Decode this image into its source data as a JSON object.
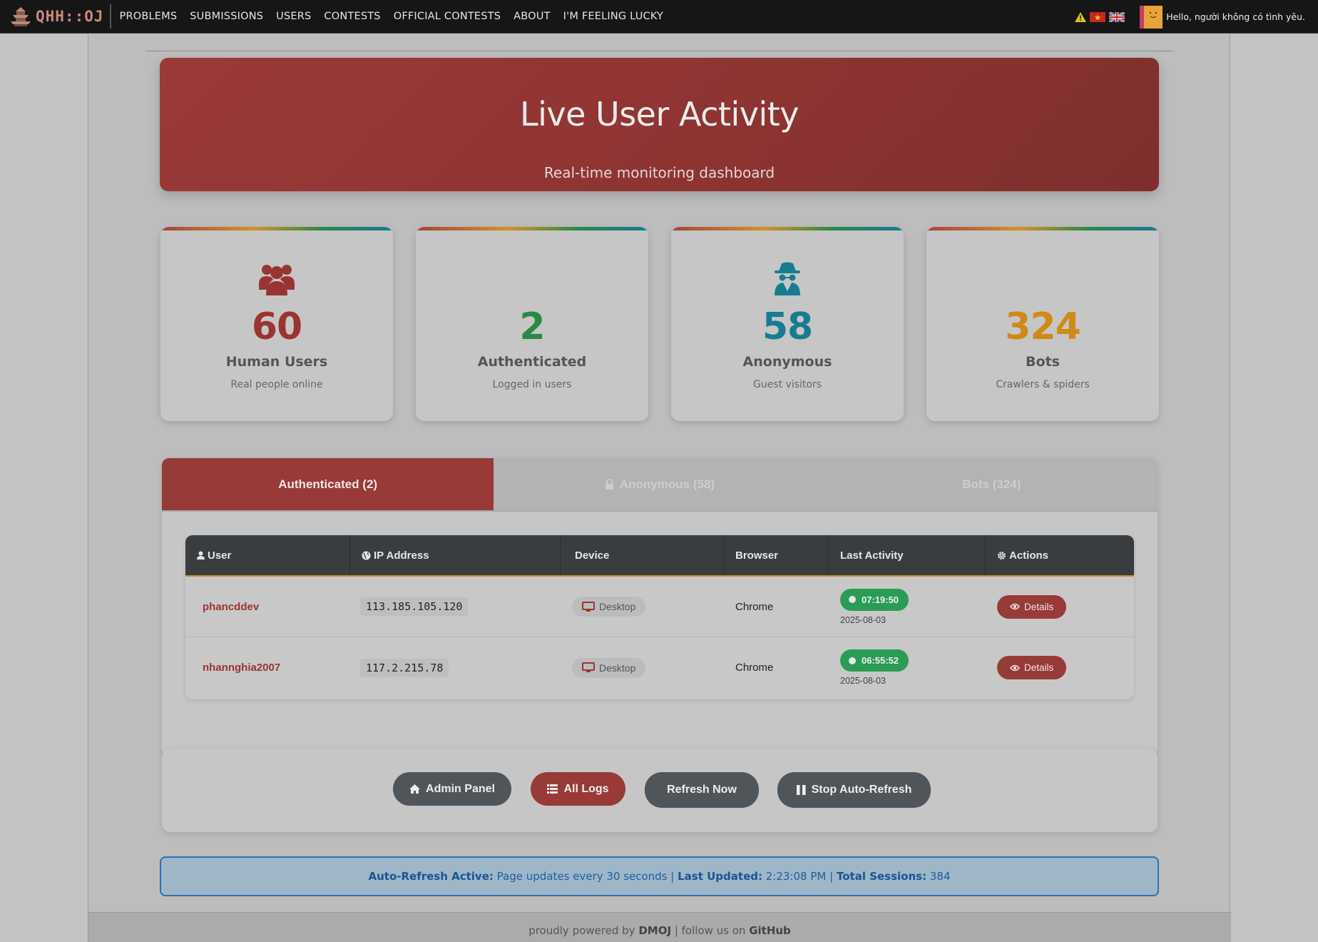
{
  "nav": {
    "logo_text": "QHH::OJ",
    "items": [
      "PROBLEMS",
      "SUBMISSIONS",
      "USERS",
      "CONTESTS",
      "OFFICIAL CONTESTS",
      "ABOUT",
      "I'M FEELING LUCKY"
    ],
    "greeting": "Hello, người không có tình yêu.",
    "icons": [
      "warning-icon",
      "vietnam-flag-icon",
      "uk-flag-icon"
    ]
  },
  "hero": {
    "title": "Live User Activity",
    "subtitle": "Real-time monitoring dashboard"
  },
  "stats": [
    {
      "value": "60",
      "label": "Human Users",
      "desc": "Real people online",
      "color": "#9a3433",
      "icon": "users-icon"
    },
    {
      "value": "2",
      "label": "Authenticated",
      "desc": "Logged in users",
      "color": "#2a8a44",
      "icon": ""
    },
    {
      "value": "58",
      "label": "Anonymous",
      "desc": "Guest visitors",
      "color": "#187c90",
      "icon": "incognito-icon"
    },
    {
      "value": "324",
      "label": "Bots",
      "desc": "Crawlers & spiders",
      "color": "#cf8a17",
      "icon": ""
    }
  ],
  "tabs": [
    {
      "label": "Authenticated (2)",
      "active": true
    },
    {
      "label": "Anonymous (58)",
      "active": false
    },
    {
      "label": "Bots (324)",
      "active": false
    }
  ],
  "table": {
    "headers": [
      "User",
      "IP Address",
      "Device",
      "Browser",
      "Last Activity",
      "Actions"
    ],
    "rows": [
      {
        "user": "phancddev",
        "ip": "113.185.105.120",
        "device": "Desktop",
        "browser": "Chrome",
        "time": "07:19:50",
        "date": "2025-08-03",
        "action": "Details"
      },
      {
        "user": "nhannghia2007",
        "ip": "117.2.215.78",
        "device": "Desktop",
        "browser": "Chrome",
        "time": "06:55:52",
        "date": "2025-08-03",
        "action": "Details"
      }
    ]
  },
  "buttons": {
    "admin": "Admin Panel",
    "logs": "All Logs",
    "refresh": "Refresh Now",
    "stop": "Stop Auto-Refresh"
  },
  "info": {
    "auto_label": "Auto-Refresh Active:",
    "auto_text": "Page updates every 30 seconds",
    "updated_label": "Last Updated:",
    "updated_value": "2:23:08 PM",
    "sessions_label": "Total Sessions:",
    "sessions_value": "384",
    "separator": "|"
  },
  "footer": {
    "prefix": "proudly powered by",
    "dmoj": "DMOJ",
    "middle": "| follow us on",
    "github": "GitHub"
  }
}
